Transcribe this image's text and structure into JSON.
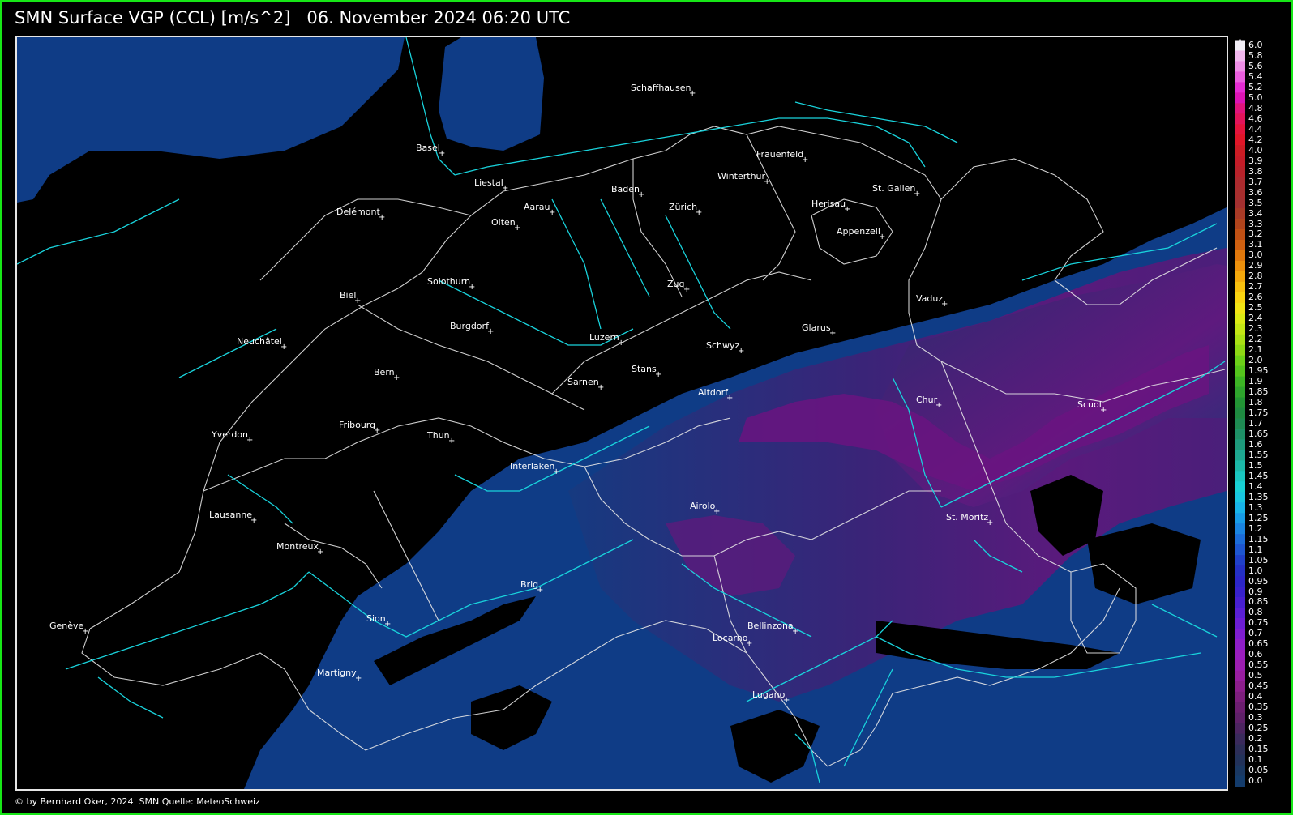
{
  "header": {
    "product": "SMN Surface VGP (CCL) [m/s^2]",
    "datetime": "06. November 2024 06:20 UTC"
  },
  "footer": {
    "credit": "© by Bernhard Oker, 2024",
    "source": "SMN Quelle: MeteoSchweiz"
  },
  "colors": {
    "frame": "#17e617",
    "map_border": "#e6e6e6",
    "rivers": "#19d3dc",
    "borders": "#e6e6e6",
    "low_value_blue": "#0f3c86",
    "mid_value_purple": "#4a1f7a",
    "high_value_magenta": "#7a1080"
  },
  "cities": [
    {
      "name": "Schaffhausen"
    },
    {
      "name": "Basel"
    },
    {
      "name": "Frauenfeld"
    },
    {
      "name": "Liestal"
    },
    {
      "name": "Winterthur"
    },
    {
      "name": "Baden"
    },
    {
      "name": "St. Gallen"
    },
    {
      "name": "Herisau"
    },
    {
      "name": "Delémont"
    },
    {
      "name": "Aarau"
    },
    {
      "name": "Zürich"
    },
    {
      "name": "Olten"
    },
    {
      "name": "Appenzell"
    },
    {
      "name": "Solothurn"
    },
    {
      "name": "Zug"
    },
    {
      "name": "Vaduz"
    },
    {
      "name": "Biel"
    },
    {
      "name": "Burgdorf"
    },
    {
      "name": "Glarus"
    },
    {
      "name": "Luzern"
    },
    {
      "name": "Neuchâtel"
    },
    {
      "name": "Schwyz"
    },
    {
      "name": "Bern"
    },
    {
      "name": "Stans"
    },
    {
      "name": "Sarnen"
    },
    {
      "name": "Altdorf"
    },
    {
      "name": "Chur"
    },
    {
      "name": "Scuol"
    },
    {
      "name": "Fribourg"
    },
    {
      "name": "Yverdon"
    },
    {
      "name": "Thun"
    },
    {
      "name": "Interlaken"
    },
    {
      "name": "Airolo"
    },
    {
      "name": "St. Moritz"
    },
    {
      "name": "Lausanne"
    },
    {
      "name": "Montreux"
    },
    {
      "name": "Brig"
    },
    {
      "name": "Genève"
    },
    {
      "name": "Sion"
    },
    {
      "name": "Bellinzona"
    },
    {
      "name": "Locarno"
    },
    {
      "name": "Martigny"
    },
    {
      "name": "Lugano"
    }
  ],
  "scale": {
    "min": 0.0,
    "max": 6.0,
    "labels": [
      "6.0",
      "5.8",
      "5.6",
      "5.4",
      "5.2",
      "5.0",
      "4.8",
      "4.6",
      "4.4",
      "4.2",
      "4.0",
      "3.9",
      "3.8",
      "3.7",
      "3.6",
      "3.5",
      "3.4",
      "3.3",
      "3.2",
      "3.1",
      "3.0",
      "2.9",
      "2.8",
      "2.7",
      "2.6",
      "2.5",
      "2.4",
      "2.3",
      "2.2",
      "2.1",
      "2.0",
      "1.95",
      "1.9",
      "1.85",
      "1.8",
      "1.75",
      "1.7",
      "1.65",
      "1.6",
      "1.55",
      "1.5",
      "1.45",
      "1.4",
      "1.35",
      "1.3",
      "1.25",
      "1.2",
      "1.15",
      "1.1",
      "1.05",
      "1.0",
      "0.95",
      "0.9",
      "0.85",
      "0.8",
      "0.75",
      "0.7",
      "0.65",
      "0.6",
      "0.55",
      "0.5",
      "0.45",
      "0.4",
      "0.35",
      "0.3",
      "0.25",
      "0.2",
      "0.15",
      "0.1",
      "0.05",
      "0.0"
    ],
    "colors": [
      "#f2eef6",
      "#f2b8ee",
      "#ee8ee6",
      "#ea5ede",
      "#e42cd2",
      "#dc14b4",
      "#e0147c",
      "#e2145a",
      "#e4143c",
      "#e01628",
      "#cc1c24",
      "#c41c28",
      "#b8222a",
      "#ac2a2e",
      "#a82e2e",
      "#a43030",
      "#a83a26",
      "#b0441c",
      "#c05014",
      "#d06010",
      "#e0780c",
      "#ec900c",
      "#f4a80c",
      "#f8c00e",
      "#fad410",
      "#f2e414",
      "#dcea14",
      "#c4e614",
      "#aae014",
      "#8ed814",
      "#6cd018",
      "#54c41c",
      "#3cb424",
      "#2ea42c",
      "#229434",
      "#1e8a40",
      "#1e8a52",
      "#1e9066",
      "#1e9a7c",
      "#1ea890",
      "#1cb8a8",
      "#1ac6c0",
      "#18d0d4",
      "#18c6e0",
      "#18b4e8",
      "#189ce6",
      "#1a84e0",
      "#1c6cd8",
      "#1e56d0",
      "#2040c8",
      "#2430c4",
      "#2c26c8",
      "#3822cc",
      "#4820d0",
      "#5a20d4",
      "#6c1ed4",
      "#7e1ed0",
      "#8e1ec8",
      "#9a1ebe",
      "#9c1eb0",
      "#981ea0",
      "#8c1e8c",
      "#7c1e7c",
      "#6c1e70",
      "#5e2068",
      "#4c2460",
      "#3a2a5c",
      "#2c2e58",
      "#22325a",
      "#1a3862",
      "#143c6c"
    ]
  }
}
